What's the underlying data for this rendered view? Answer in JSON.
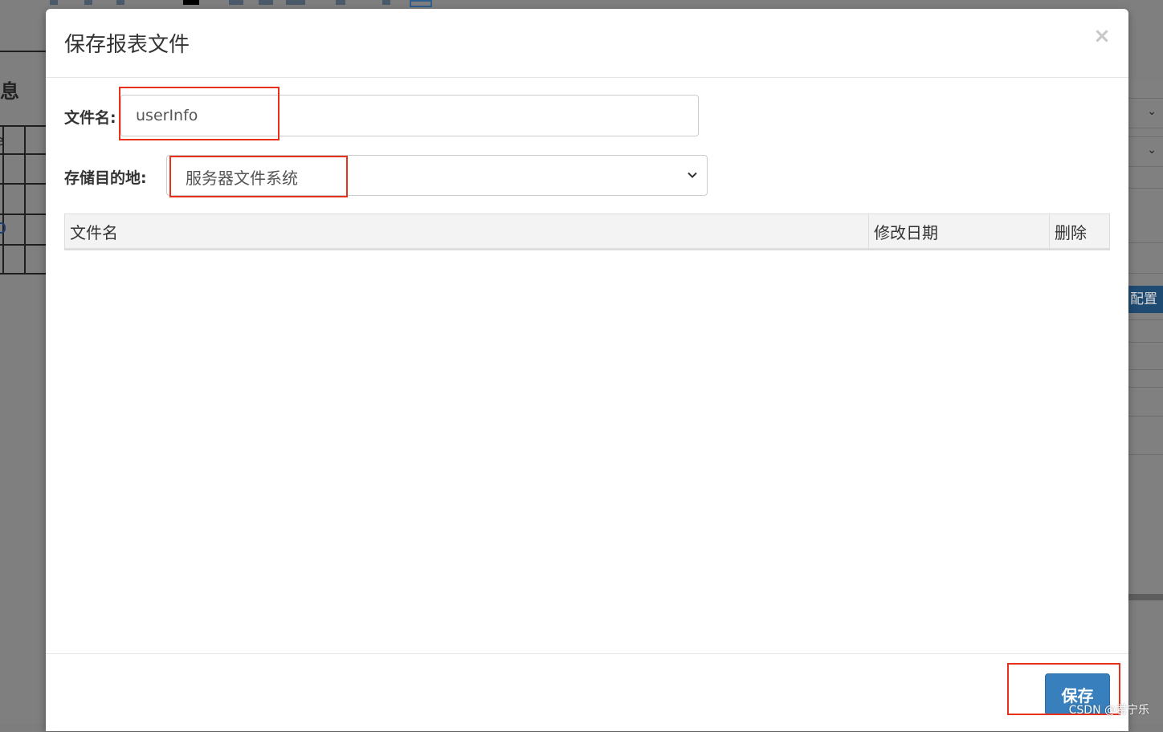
{
  "background": {
    "left_title": "信息",
    "left_cell_text": "e",
    "right_button_label": "配置"
  },
  "dialog": {
    "title": "保存报表文件",
    "close_icon": "×",
    "filename_label": "文件名:",
    "filename_value": "userInfo",
    "destination_label": "存储目的地:",
    "destination_value": "服务器文件系统",
    "table": {
      "columns": [
        "文件名",
        "修改日期",
        "删除"
      ],
      "rows": []
    },
    "save_label": "保存"
  },
  "highlight_color": "#e8311a",
  "accent_color": "#3880bd",
  "watermark": "CSDN @君宁乐"
}
